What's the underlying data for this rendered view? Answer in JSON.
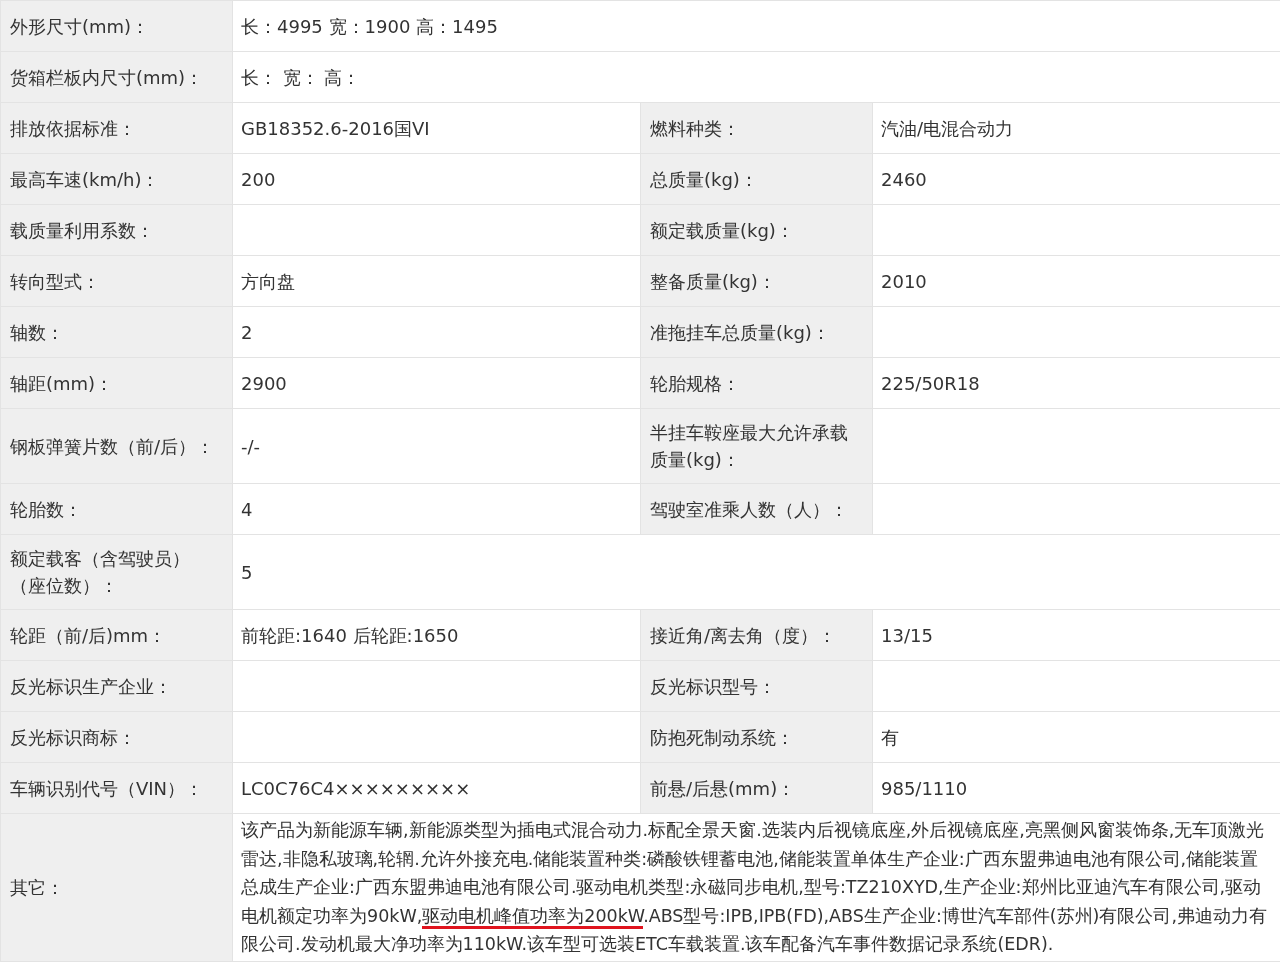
{
  "rows": [
    {
      "cells": [
        {
          "label": "外形尺寸(mm)：",
          "value": "长：4995 宽：1900 高：1495"
        }
      ]
    },
    {
      "cells": [
        {
          "label": "货箱栏板内尺寸(mm)：",
          "value": "长： 宽： 高："
        }
      ]
    },
    {
      "cells": [
        {
          "label": "排放依据标准：",
          "value": "GB18352.6-2016国VI"
        },
        {
          "label": "燃料种类：",
          "value": "汽油/电混合动力"
        }
      ]
    },
    {
      "cells": [
        {
          "label": "最高车速(km/h)：",
          "value": "200"
        },
        {
          "label": "总质量(kg)：",
          "value": "2460"
        }
      ]
    },
    {
      "cells": [
        {
          "label": "载质量利用系数："
        },
        {
          "label": "额定载质量(kg)："
        }
      ]
    },
    {
      "cells": [
        {
          "label": "转向型式：",
          "value": "方向盘"
        },
        {
          "label": "整备质量(kg)：",
          "value": "2010"
        }
      ]
    },
    {
      "cells": [
        {
          "label": "轴数：",
          "value": "2"
        },
        {
          "label": "准拖挂车总质量(kg)："
        }
      ]
    },
    {
      "cells": [
        {
          "label": "轴距(mm)：",
          "value": "2900"
        },
        {
          "label": "轮胎规格：",
          "value": "225/50R18"
        }
      ]
    },
    {
      "cells": [
        {
          "label": "钢板弹簧片数（前/后）：",
          "value": "-/-"
        },
        {
          "label": "半挂车鞍座最大允许承载质量(kg)："
        }
      ]
    },
    {
      "cells": [
        {
          "label": "轮胎数：",
          "value": "4"
        },
        {
          "label": "驾驶室准乘人数（人）："
        }
      ]
    },
    {
      "cells": [
        {
          "label": "额定载客（含驾驶员）（座位数）：",
          "value": "5"
        }
      ]
    },
    {
      "cells": [
        {
          "label": "轮距（前/后)mm：",
          "value": "前轮距:1640 后轮距:1650"
        },
        {
          "label": "接近角/离去角（度）：",
          "value": "13/15"
        }
      ]
    },
    {
      "cells": [
        {
          "label": "反光标识生产企业："
        },
        {
          "label": "反光标识型号："
        }
      ]
    },
    {
      "cells": [
        {
          "label": "反光标识商标："
        },
        {
          "label": "防抱死制动系统：",
          "value": "有"
        }
      ]
    },
    {
      "cells": [
        {
          "label": "车辆识别代号（VIN）：",
          "value": "LC0C76C4×××××××××"
        },
        {
          "label": "前悬/后悬(mm)：",
          "value": "985/1110"
        }
      ]
    }
  ],
  "remarks": {
    "label": "其它：",
    "segments": [
      {
        "text": "该产品为新能源车辆,新能源类型为插电式混合动力.标配全景天窗.选装内后视镜底座,外后视镜底座,亮黑侧风窗装饰条,无车顶激光雷达,非隐私玻璃,轮辋.允许外接充电.储能装置种类:磷酸铁锂蓄电池,储能装置单体生产企业:广西东盟弗迪电池有限公司,储能装置总成生产企业:广西东盟弗迪电池有限公司.驱动电机类型:永磁同步电机,型号:TZ210XYD,生产企业:郑州比亚迪汽车有限公司,驱动电机额定功率为90kW,",
        "underlined": false
      },
      {
        "text": "驱动电机峰值功率为200kW",
        "underlined": true
      },
      {
        "text": ".ABS型号:IPB,IPB(FD),ABS生产企业:博世汽车部件(苏州)有限公司,弗迪动力有限公司.发动机最大净功率为110kW.该车型可选装ETC车载装置.该车配备汽车事件数据记录系统(EDR).",
        "underlined": false
      }
    ]
  }
}
